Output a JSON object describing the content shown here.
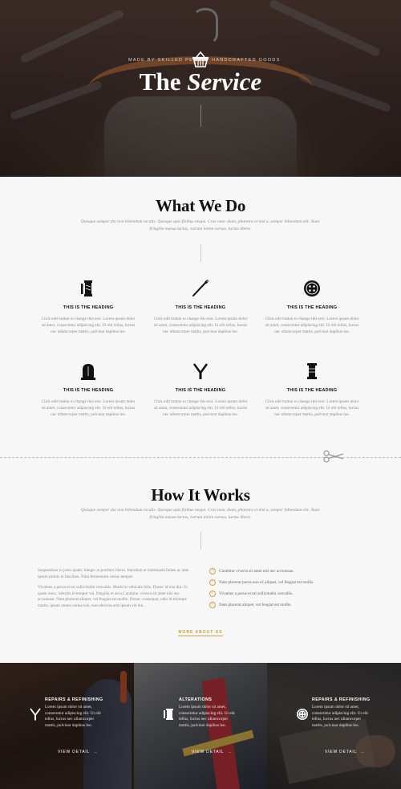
{
  "hero": {
    "tag_left": "MADE BY SKILLED PEOPLE",
    "tag_right": "HANDCRAFTED GOODS",
    "title_the": "The",
    "title_service": "Service"
  },
  "what_we_do": {
    "title": "What We Do",
    "subtitle": "Quisque semper dui non bibendum iaculis. Quisque quis finibus neque. Cras nunc diam, pharetra et nisl a, semper bibendum elit. Nunc fringilla massa luctus, rutrum lorem cursus, luctus libero.",
    "features": [
      {
        "icon": "spool-icon",
        "heading": "THIS IS THE HEADING",
        "text": "Click edit button to change this text. Lorem ipsum dolor sit amet, consectetur adipiscing elit. Ut elit tellus, luctus nec ullamcorper mattis, pulvinar dapibus leo."
      },
      {
        "icon": "needle-icon",
        "heading": "THIS IS THE HEADING",
        "text": "Click edit button to change this text. Lorem ipsum dolor sit amet, consectetur adipiscing elit. Ut elit tellus, luctus nec ullamcorper mattis, pulvinar dapibus leo."
      },
      {
        "icon": "button-icon",
        "heading": "THIS IS THE HEADING",
        "text": "Click edit button to change this text. Lorem ipsum dolor sit amet, consectetur adipiscing elit. Ut elit tellus, luctus nec ullamcorper mattis, pulvinar dapibus leo."
      },
      {
        "icon": "mannequin-icon",
        "heading": "THIS IS THE HEADING",
        "text": "Click edit button to change this text. Lorem ipsum dolor sit amet, consectetur adipiscing elit. Ut elit tellus, luctus nec ullamcorper mattis, pulvinar dapibus leo."
      },
      {
        "icon": "scissors-icon",
        "heading": "THIS IS THE HEADING",
        "text": "Click edit button to change this text. Lorem ipsum dolor sit amet, consectetur adipiscing elit. Ut elit tellus, luctus nec ullamcorper mattis, pulvinar dapibus leo."
      },
      {
        "icon": "thread-icon",
        "heading": "THIS IS THE HEADING",
        "text": "Click edit button to change this text. Lorem ipsum dolor sit amet, consectetur adipiscing elit. Ut elit tellus, luctus nec ullamcorper mattis, pulvinar dapibus leo."
      }
    ]
  },
  "how_it_works": {
    "title": "How It Works",
    "subtitle": "Quisque semper dui non bibendum iaculis. Quisque quis finibus neque. Cras nunc diam, pharetra et nisl a, semper bibendum elit. Nunc fringilla massa luctus, rutrum lorem cursus, luctus libero.",
    "para1": "Suspendisse in justo quam. Integer at porttitor libero. Interdum et malesuada fames ac ante ipsum primis in faucibus. Nam fermentum varius tempor.",
    "para2": "Vivamus a purus et mi sollicitudin convallis. Morbi at vehicula felis. Donec id nisi dui. Ut quam nunc, lobortis id tempor vel, fringilla et arcu.Curabitur viverra sit amet nisl nec accumsan. Nam placerat aliquet, vel feugiat est mollis. Donec consequat, odio id tristique mattis, ipsum metus varius nisi, non ultricies erat ipsum vel dui.",
    "checklist": [
      "Curabitur viverra sit amet nisl nec accumsan.",
      "Nam placerat purus non ex aliquet, vel feugiat est mollis.",
      "Vivamus a purus et mi sollicitudin convallis.",
      "Nam placerat aliquet, vel feugiat est mollis."
    ],
    "more_link": "MORE ABOUT US"
  },
  "panels": [
    {
      "icon": "scissors-icon",
      "title": "REPAIRS & REFINISHING",
      "text": "Lorem ipsum dolor sit amet, consectetur adipiscing elit. Ut elit tellus, luctus nec ullamcorper mattis, pulvinar dapibus leo.",
      "link": "VIEW DETAIL"
    },
    {
      "icon": "spool-icon",
      "title": "ALTERATIONS",
      "text": "Lorem ipsum dolor sit amet, consectetur adipiscing elit. Ut elit tellus, luctus nec ullamcorper mattis, pulvinar dapibus leo.",
      "link": "VIEW DETAIL"
    },
    {
      "icon": "button-icon",
      "title": "REPAIRS & REFINISHING",
      "text": "Lorem ipsum dolor sit amet, consectetur adipiscing elit. Ut elit tellus, luctus nec ullamcorper mattis, pulvinar dapibus leo.",
      "link": "VIEW DETAIL"
    }
  ],
  "colors": {
    "accent": "#c9a24a",
    "dark": "#111111",
    "hero_bg": "#2a1f1c"
  }
}
